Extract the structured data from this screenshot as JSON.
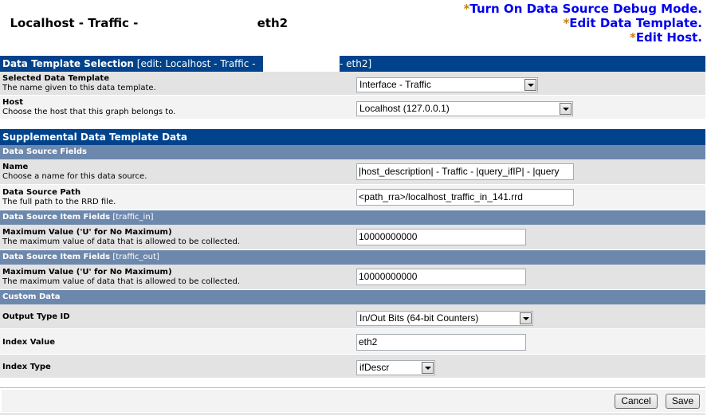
{
  "page": {
    "title_prefix": "Localhost - Traffic - ",
    "title_suffix": "eth2"
  },
  "actions": [
    {
      "star": "*",
      "label": "Turn On Data Source Debug Mode."
    },
    {
      "star": "*",
      "label": "Edit Data Template."
    },
    {
      "star": "*",
      "label": "Edit Host."
    }
  ],
  "template_section": {
    "title": "Data Template Selection",
    "edit_prefix": "[edit: Localhost - Traffic - ",
    "edit_suffix": "- eth2]",
    "rows": [
      {
        "label": "Selected Data Template",
        "desc": "The name given to this data template.",
        "value": "Interface - Traffic"
      },
      {
        "label": "Host",
        "desc": "Choose the host that this graph belongs to.",
        "value": "Localhost (127.0.0.1)"
      }
    ]
  },
  "supplemental": {
    "title": "Supplemental Data Template Data",
    "ds_fields": {
      "title": "Data Source Fields",
      "name": {
        "label": "Name",
        "desc": "Choose a name for this data source.",
        "value": "|host_description| - Traffic - |query_ifIP| - |query"
      },
      "path": {
        "label": "Data Source Path",
        "desc": "The full path to the RRD file.",
        "value": "<path_rra>/localhost_traffic_in_141.rrd"
      }
    },
    "item_in": {
      "title": "Data Source Item Fields",
      "tag": "[traffic_in]",
      "label": "Maximum Value ('U' for No Maximum)",
      "desc": "The maximum value of data that is allowed to be collected.",
      "value": "10000000000"
    },
    "item_out": {
      "title": "Data Source Item Fields",
      "tag": "[traffic_out]",
      "label": "Maximum Value ('U' for No Maximum)",
      "desc": "The maximum value of data that is allowed to be collected.",
      "value": "10000000000"
    },
    "custom": {
      "title": "Custom Data",
      "output_type": {
        "label": "Output Type ID",
        "value": "In/Out Bits (64-bit Counters)"
      },
      "index_value": {
        "label": "Index Value",
        "value": "eth2"
      },
      "index_type": {
        "label": "Index Type",
        "value": "ifDescr"
      }
    }
  },
  "footer": {
    "cancel": "Cancel",
    "save": "Save"
  }
}
